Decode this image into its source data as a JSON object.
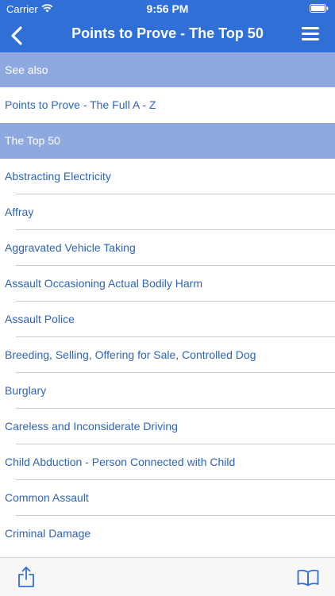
{
  "status_bar": {
    "carrier": "Carrier",
    "time": "9:56 PM",
    "wifi_icon": "wifi-icon",
    "battery_icon": "battery-full-icon"
  },
  "nav": {
    "back_icon": "chevron-left-icon",
    "title": "Points to Prove - The Top 50",
    "menu_icon": "hamburger-menu-icon"
  },
  "list": {
    "section_header": "See also",
    "items": [
      {
        "label": "Points to Prove - The Full A - Z",
        "selected": false
      },
      {
        "label": "The Top 50",
        "selected": true
      },
      {
        "label": "Abstracting Electricity",
        "selected": false
      },
      {
        "label": "Affray",
        "selected": false
      },
      {
        "label": "Aggravated Vehicle Taking",
        "selected": false
      },
      {
        "label": "Assault Occasioning Actual Bodily Harm",
        "selected": false
      },
      {
        "label": "Assault Police",
        "selected": false
      },
      {
        "label": "Breeding, Selling, Offering for Sale, Controlled Dog",
        "selected": false
      },
      {
        "label": "Burglary",
        "selected": false
      },
      {
        "label": "Careless and Inconsiderate Driving",
        "selected": false
      },
      {
        "label": "Child Abduction - Person Connected with Child",
        "selected": false
      },
      {
        "label": "Common Assault",
        "selected": false
      },
      {
        "label": "Criminal Damage",
        "selected": false
      }
    ]
  },
  "toolbar": {
    "share_icon": "share-icon",
    "book_icon": "book-icon"
  },
  "colors": {
    "nav_bar": "#2f6fd6",
    "highlight": "#8ea8e0",
    "link_text": "#2f64b8"
  }
}
